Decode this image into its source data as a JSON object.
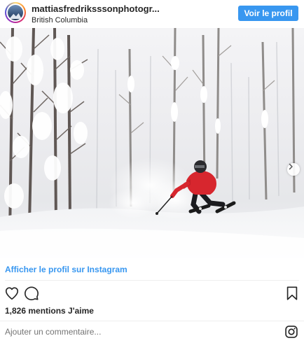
{
  "header": {
    "username": "mattiasfredriksssonphotogr...",
    "location": "British Columbia",
    "view_profile_label": "Voir le profil"
  },
  "post": {
    "image_icon": "skier-in-snowy-forest-photo",
    "next_icon": "chevron-right-icon"
  },
  "footer": {
    "view_on_instagram": "Afficher le profil sur Instagram",
    "likes": "1,826 mentions J'aime",
    "comment_placeholder": "Ajouter un commentaire...",
    "icons": [
      "heart-icon",
      "comment-icon",
      "bookmark-icon",
      "instagram-logo-icon"
    ]
  },
  "colors": {
    "accent": "#3897f0",
    "text": "#262626",
    "muted": "#8e8e8e",
    "jacket": "#d7262e"
  }
}
